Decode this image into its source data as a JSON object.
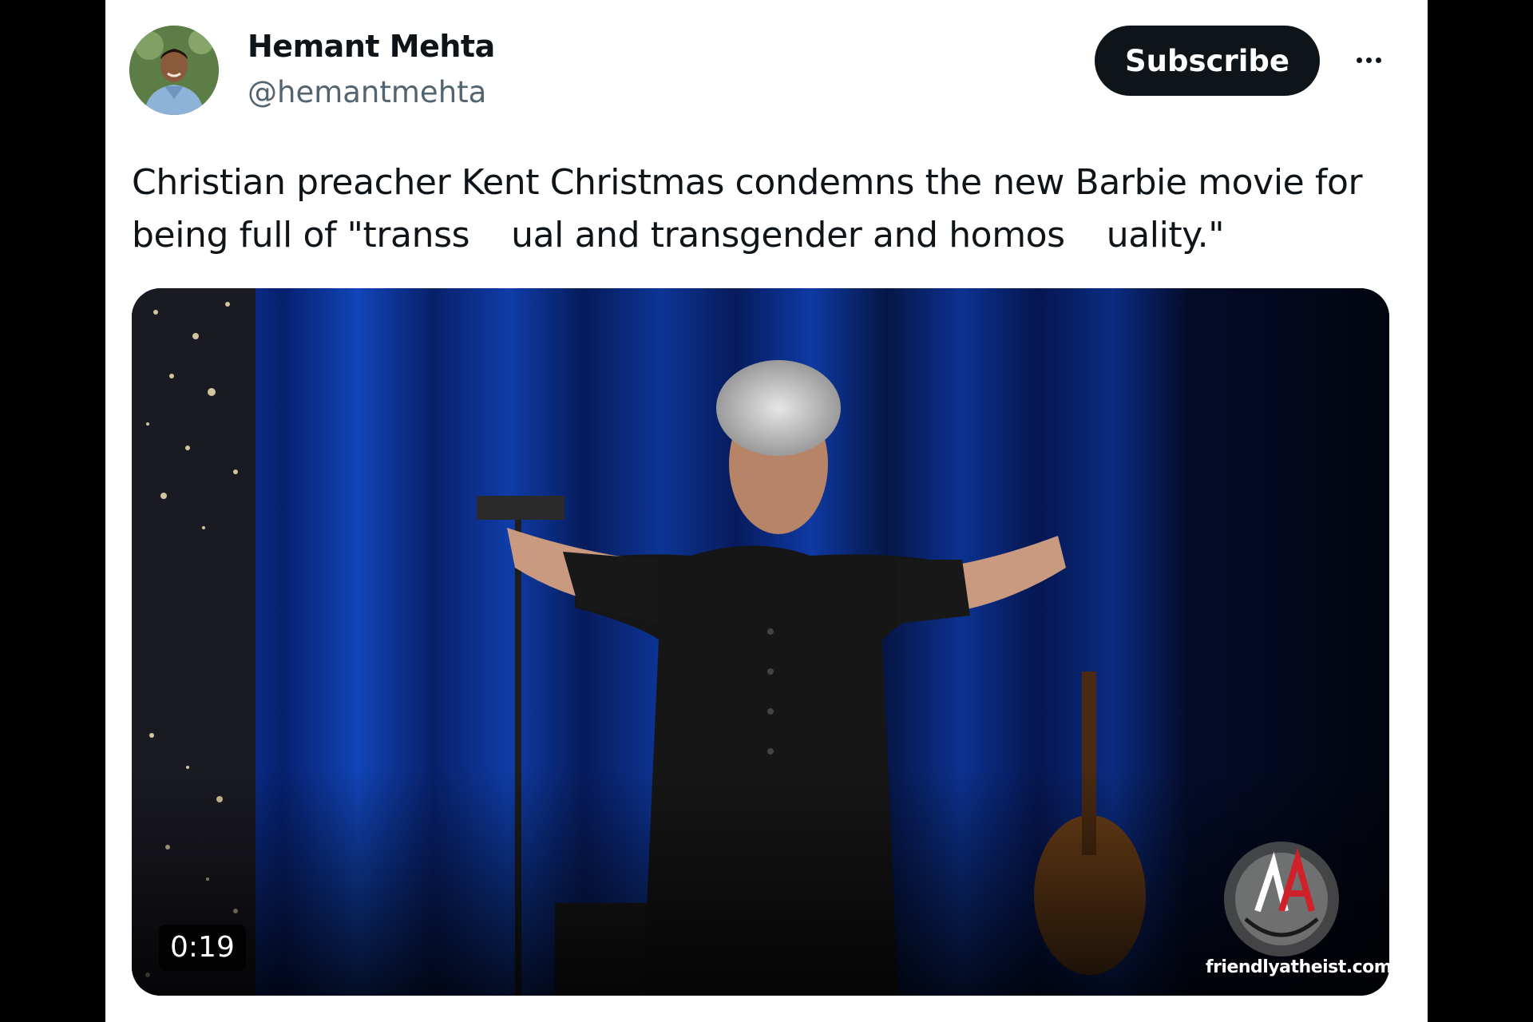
{
  "tweet": {
    "author": {
      "display_name": "Hemant Mehta",
      "handle": "@hemantmehta",
      "avatar_icon": "profile-photo"
    },
    "subscribe_label": "Subscribe",
    "more_icon": "ellipsis-icon",
    "text_lines": [
      "Christian preacher Kent Christmas condemns the new Barbie movie for",
      "being full of \"transs",
      "ual and transgender and homos",
      "uality.\""
    ],
    "media": {
      "type": "video",
      "duration": "0:19",
      "watermark": "friendlyatheist.com"
    }
  },
  "colors": {
    "text_primary": "#0f1419",
    "text_secondary": "#536471",
    "button_bg": "#0f1419",
    "curtain_blue": "#0b2a8a",
    "watermark_red": "#d0202a"
  }
}
